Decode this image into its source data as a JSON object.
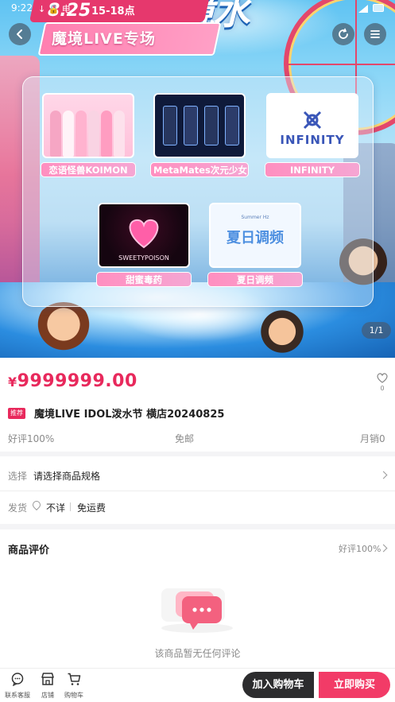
{
  "status_bar": {
    "time": "9:22",
    "icons_text": "↓ 🔒 电"
  },
  "banner": {
    "date": "8.25",
    "time_range": "15-18点",
    "title": "魔境LIVE专场",
    "pager": "1/1",
    "artists": [
      {
        "label": "恋语怪兽KOIMON"
      },
      {
        "label": "MetaMates次元少女"
      },
      {
        "label": "INFINITY"
      },
      {
        "label": "甜蜜毒药"
      },
      {
        "label": "夏日调频"
      }
    ]
  },
  "product": {
    "price_symbol": "¥",
    "price": "9999999.00",
    "favorite_count": "0",
    "tag": "推荐",
    "title": "魔境LIVE IDOL泼水节 横店20240825",
    "positive_rate": "好评100%",
    "shipping_fee": "免邮",
    "monthly_sales": "月销0"
  },
  "spec": {
    "select_label": "选择",
    "select_value": "请选择商品规格",
    "ship_label": "发货",
    "ship_origin": "不详",
    "ship_fee": "免运费"
  },
  "reviews": {
    "title": "商品评价",
    "rate": "好评100%",
    "empty_text": "该商品暂无任何评论"
  },
  "bottom_bar": {
    "service": "联系客服",
    "store": "店铺",
    "cart": "购物车",
    "add_to_cart": "加入购物车",
    "buy_now": "立即购买"
  },
  "colors": {
    "accent": "#e8295c",
    "buy_button": "#f23b67",
    "cart_button": "#2c2c2e"
  }
}
